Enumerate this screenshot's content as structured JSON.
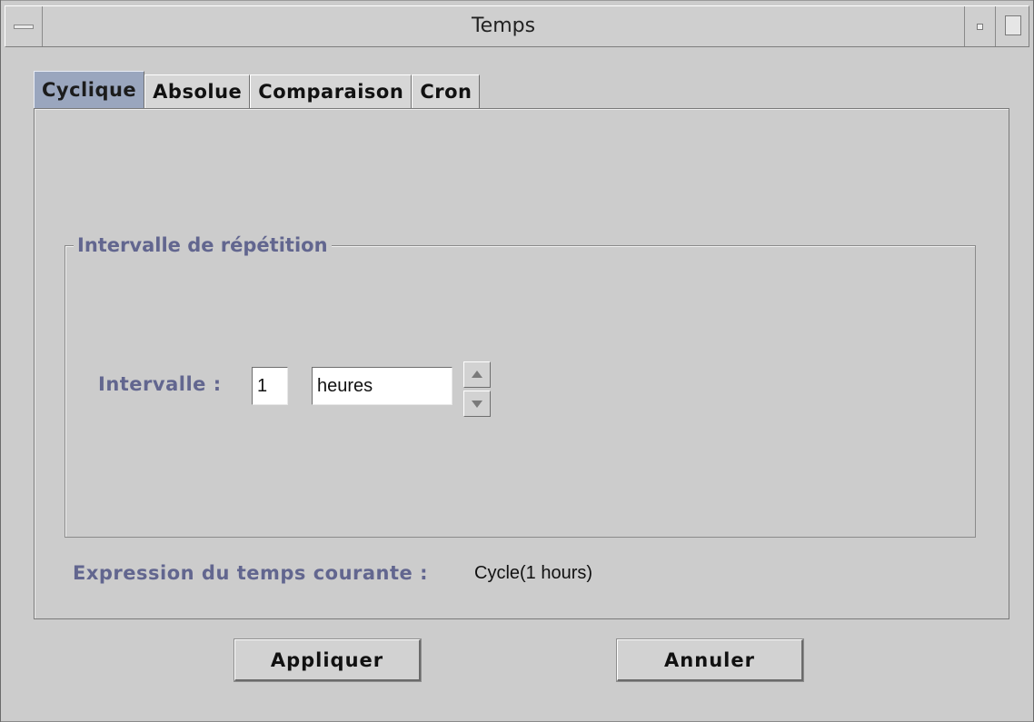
{
  "window": {
    "title": "Temps"
  },
  "tabs": [
    {
      "label": "Cyclique",
      "active": true
    },
    {
      "label": "Absolue",
      "active": false
    },
    {
      "label": "Comparaison",
      "active": false
    },
    {
      "label": "Cron",
      "active": false
    }
  ],
  "repeat_group": {
    "legend": "Intervalle de répétition",
    "interval_label": "Intervalle :",
    "interval_value": "1",
    "unit_value": "heures"
  },
  "current_expression": {
    "label": "Expression du temps courante :",
    "value": "Cycle(1 hours)"
  },
  "buttons": {
    "apply": "Appliquer",
    "cancel": "Annuler"
  },
  "colors": {
    "label_accent": "#62668f",
    "active_tab": "#9aa6be",
    "background": "#cccccc"
  }
}
